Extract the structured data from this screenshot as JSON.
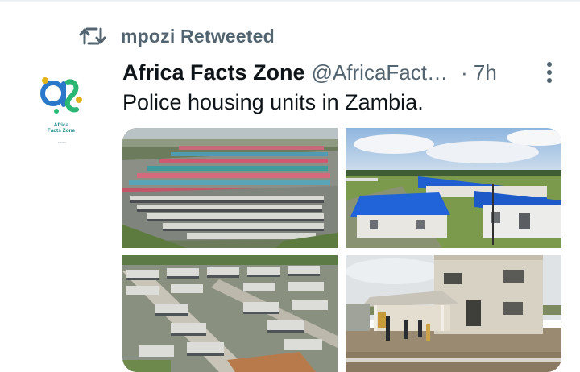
{
  "retweet": {
    "label": "mpozi Retweeted",
    "icon": "retweet-icon"
  },
  "author": {
    "name": "Africa Facts Zone",
    "handle": "@AfricaFact…",
    "time": "· 7h",
    "avatar_text": "Africa\nFacts Zone",
    "avatar_subtext": "-------",
    "avatar_icon": "africa-facts-zone-logo"
  },
  "tweet": {
    "text": "Police housing units in Zambia."
  },
  "media": {
    "photos": [
      {
        "name": "aerial-housing-rows-photo"
      },
      {
        "name": "blue-roof-houses-photo"
      },
      {
        "name": "aerial-grey-roof-estate-photo"
      },
      {
        "name": "two-storey-house-photo"
      }
    ]
  },
  "colors": {
    "secondary_text": "#536471",
    "primary_text": "#0f1419",
    "roof_blue": "#1f5fd1"
  }
}
